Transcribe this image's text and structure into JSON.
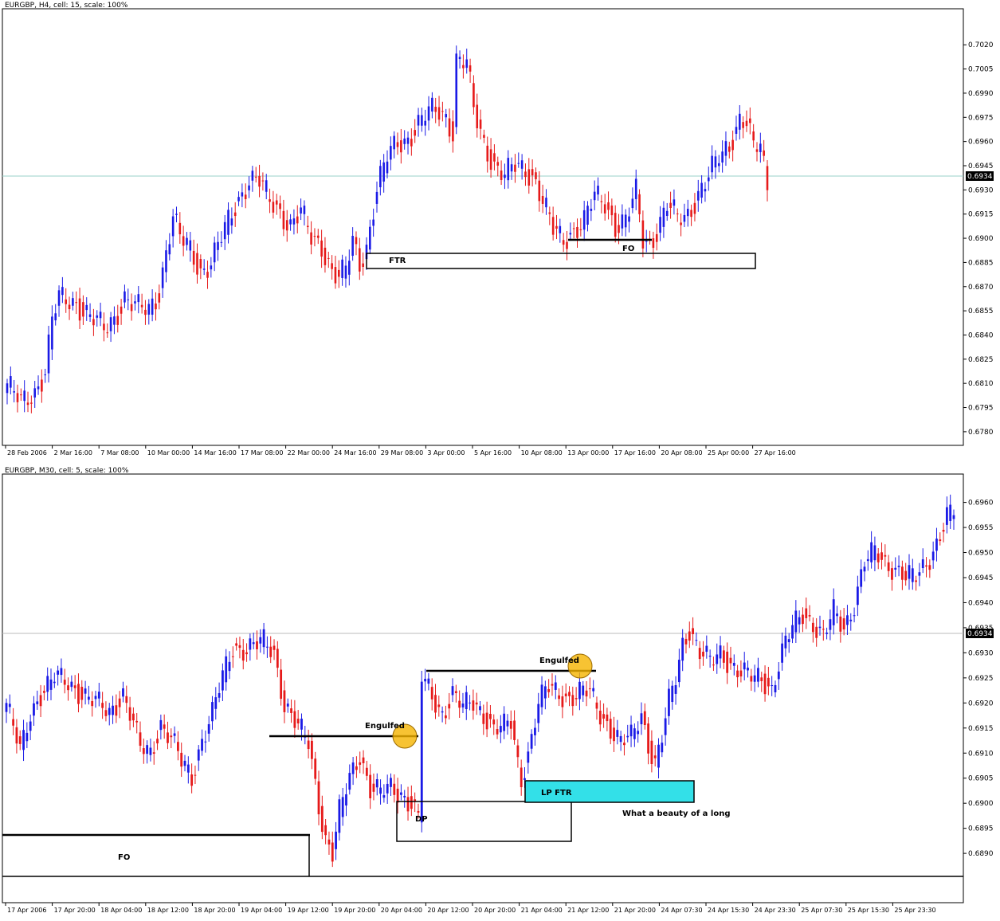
{
  "colors": {
    "bull": "#1a1ae6",
    "bear": "#e61a1a",
    "frame": "#000000",
    "grid_ref": "#9ad0c8",
    "marker": "#f5b400",
    "lp_zone": "#33e0e8"
  },
  "chart_data": [
    {
      "type": "candlestick",
      "title": "EURGBP, H4, cell: 15, scale: 100%",
      "symbol": "EURGBP",
      "timeframe": "H4",
      "ylim": [
        0.6775,
        0.703
      ],
      "y_ticks": [
        "0.7020",
        "0.7005",
        "0.6990",
        "0.6975",
        "0.6960",
        "0.6945",
        "0.6930",
        "0.6915",
        "0.6900",
        "0.6885",
        "0.6870",
        "0.6855",
        "0.6840",
        "0.6825",
        "0.6810",
        "0.6795",
        "0.6780"
      ],
      "x_ticks": [
        "28 Feb 2006",
        "2 Mar 16:00",
        "7 Mar 08:00",
        "10 Mar 00:00",
        "14 Mar 16:00",
        "17 Mar 08:00",
        "22 Mar 00:00",
        "24 Mar 16:00",
        "29 Mar 08:00",
        "3 Apr 00:00",
        "5 Apr 16:00",
        "10 Apr 08:00",
        "13 Apr 00:00",
        "17 Apr 16:00",
        "20 Apr 08:00",
        "25 Apr 00:00",
        "27 Apr 16:00"
      ],
      "current_price": "0.6934",
      "close_anchors": [
        [
          0,
          0.681
        ],
        [
          4,
          0.6797
        ],
        [
          8,
          0.6805
        ],
        [
          11,
          0.6818
        ],
        [
          13,
          0.685
        ],
        [
          15,
          0.6862
        ],
        [
          20,
          0.686
        ],
        [
          24,
          0.6852
        ],
        [
          28,
          0.6843
        ],
        [
          31,
          0.685
        ],
        [
          34,
          0.6864
        ],
        [
          38,
          0.6856
        ],
        [
          41,
          0.6855
        ],
        [
          44,
          0.6867
        ],
        [
          46,
          0.6893
        ],
        [
          48,
          0.6913
        ],
        [
          50,
          0.69
        ],
        [
          53,
          0.6893
        ],
        [
          56,
          0.688
        ],
        [
          59,
          0.6885
        ],
        [
          62,
          0.69
        ],
        [
          66,
          0.692
        ],
        [
          70,
          0.6937
        ],
        [
          73,
          0.6935
        ],
        [
          76,
          0.6923
        ],
        [
          79,
          0.6917
        ],
        [
          82,
          0.6908
        ],
        [
          85,
          0.6916
        ],
        [
          88,
          0.69
        ],
        [
          91,
          0.6896
        ],
        [
          94,
          0.688
        ],
        [
          96,
          0.6875
        ],
        [
          98,
          0.688
        ],
        [
          100,
          0.6898
        ],
        [
          102,
          0.6885
        ],
        [
          104,
          0.6895
        ],
        [
          107,
          0.693
        ],
        [
          110,
          0.695
        ],
        [
          113,
          0.696
        ],
        [
          116,
          0.6962
        ],
        [
          119,
          0.697
        ],
        [
          122,
          0.6978
        ],
        [
          125,
          0.698
        ],
        [
          127,
          0.6976
        ],
        [
          129,
          0.6966
        ],
        [
          130,
          0.701
        ],
        [
          133,
          0.7008
        ],
        [
          135,
          0.698
        ],
        [
          138,
          0.696
        ],
        [
          141,
          0.6945
        ],
        [
          144,
          0.6938
        ],
        [
          147,
          0.6945
        ],
        [
          150,
          0.6944
        ],
        [
          153,
          0.6935
        ],
        [
          155,
          0.6922
        ],
        [
          158,
          0.6905
        ],
        [
          161,
          0.69
        ],
        [
          164,
          0.6905
        ],
        [
          167,
          0.691
        ],
        [
          170,
          0.6926
        ],
        [
          173,
          0.6923
        ],
        [
          176,
          0.6908
        ],
        [
          179,
          0.691
        ],
        [
          182,
          0.6928
        ],
        [
          184,
          0.69
        ],
        [
          186,
          0.6897
        ],
        [
          188,
          0.6905
        ],
        [
          191,
          0.692
        ],
        [
          194,
          0.6912
        ],
        [
          197,
          0.6915
        ],
        [
          200,
          0.6928
        ],
        [
          203,
          0.6938
        ],
        [
          206,
          0.695
        ],
        [
          209,
          0.6958
        ],
        [
          212,
          0.6975
        ],
        [
          214,
          0.6972
        ],
        [
          216,
          0.6955
        ],
        [
          218,
          0.6957
        ],
        [
          220,
          0.6932
        ]
      ]
    },
    {
      "type": "candlestick",
      "title": "EURGBP, M30, cell: 5, scale: 100%",
      "symbol": "EURGBP",
      "timeframe": "M30",
      "ylim": [
        0.6887,
        0.6962
      ],
      "y_ticks": [
        "0.6960",
        "0.6955",
        "0.6950",
        "0.6945",
        "0.6940",
        "0.6935",
        "0.6930",
        "0.6925",
        "0.6920",
        "0.6915",
        "0.6910",
        "0.6905",
        "0.6900",
        "0.6895",
        "0.6890"
      ],
      "x_ticks": [
        "17 Apr 2006",
        "17 Apr 20:00",
        "18 Apr 04:00",
        "18 Apr 12:00",
        "18 Apr 20:00",
        "19 Apr 04:00",
        "19 Apr 12:00",
        "19 Apr 20:00",
        "20 Apr 04:00",
        "20 Apr 12:00",
        "20 Apr 20:00",
        "21 Apr 04:00",
        "21 Apr 12:00",
        "21 Apr 20:00",
        "24 Apr 07:30",
        "24 Apr 15:30",
        "24 Apr 23:30",
        "25 Apr 07:30",
        "25 Apr 15:30",
        "25 Apr 23:30"
      ],
      "current_price": "0.6934",
      "close_anchors": [
        [
          0,
          0.692
        ],
        [
          4,
          0.691
        ],
        [
          7,
          0.6918
        ],
        [
          10,
          0.6922
        ],
        [
          14,
          0.6925
        ],
        [
          18,
          0.6924
        ],
        [
          22,
          0.6922
        ],
        [
          26,
          0.692
        ],
        [
          30,
          0.6918
        ],
        [
          34,
          0.6922
        ],
        [
          36,
          0.6918
        ],
        [
          39,
          0.6911
        ],
        [
          42,
          0.691
        ],
        [
          45,
          0.6916
        ],
        [
          48,
          0.6913
        ],
        [
          51,
          0.6908
        ],
        [
          54,
          0.6905
        ],
        [
          57,
          0.6913
        ],
        [
          60,
          0.6918
        ],
        [
          63,
          0.6925
        ],
        [
          66,
          0.6931
        ],
        [
          70,
          0.6931
        ],
        [
          75,
          0.6932
        ],
        [
          78,
          0.693
        ],
        [
          81,
          0.692
        ],
        [
          85,
          0.6915
        ],
        [
          88,
          0.6912
        ],
        [
          91,
          0.69
        ],
        [
          93,
          0.6893
        ],
        [
          95,
          0.689
        ],
        [
          97,
          0.6898
        ],
        [
          100,
          0.6905
        ],
        [
          103,
          0.691
        ],
        [
          106,
          0.6903
        ],
        [
          109,
          0.6902
        ],
        [
          112,
          0.6903
        ],
        [
          115,
          0.6902
        ],
        [
          118,
          0.69
        ],
        [
          120,
          0.6897
        ],
        [
          121,
          0.6925
        ],
        [
          124,
          0.6921
        ],
        [
          127,
          0.6918
        ],
        [
          130,
          0.6922
        ],
        [
          133,
          0.6919
        ],
        [
          136,
          0.692
        ],
        [
          139,
          0.6918
        ],
        [
          142,
          0.6915
        ],
        [
          145,
          0.6915
        ],
        [
          147,
          0.6916
        ],
        [
          149,
          0.6908
        ],
        [
          150,
          0.6905
        ],
        [
          152,
          0.691
        ],
        [
          155,
          0.692
        ],
        [
          158,
          0.6923
        ],
        [
          161,
          0.6922
        ],
        [
          164,
          0.6921
        ],
        [
          167,
          0.6922
        ],
        [
          170,
          0.6922
        ],
        [
          173,
          0.6918
        ],
        [
          176,
          0.6915
        ],
        [
          179,
          0.6912
        ],
        [
          182,
          0.6913
        ],
        [
          185,
          0.6918
        ],
        [
          187,
          0.6912
        ],
        [
          189,
          0.6908
        ],
        [
          191,
          0.6913
        ],
        [
          193,
          0.692
        ],
        [
          195,
          0.6925
        ],
        [
          197,
          0.6932
        ],
        [
          199,
          0.6935
        ],
        [
          202,
          0.693
        ],
        [
          205,
          0.6928
        ],
        [
          208,
          0.693
        ],
        [
          211,
          0.6928
        ],
        [
          214,
          0.6926
        ],
        [
          217,
          0.6925
        ],
        [
          220,
          0.6925
        ],
        [
          223,
          0.6923
        ],
        [
          226,
          0.693
        ],
        [
          229,
          0.6935
        ],
        [
          232,
          0.6938
        ],
        [
          235,
          0.6936
        ],
        [
          238,
          0.6933
        ],
        [
          241,
          0.6938
        ],
        [
          244,
          0.6935
        ],
        [
          247,
          0.694
        ],
        [
          250,
          0.6948
        ],
        [
          253,
          0.695
        ],
        [
          256,
          0.6948
        ],
        [
          259,
          0.6947
        ],
        [
          262,
          0.6945
        ],
        [
          265,
          0.6945
        ],
        [
          268,
          0.6948
        ],
        [
          271,
          0.6952
        ],
        [
          274,
          0.6957
        ],
        [
          276,
          0.6958
        ]
      ]
    }
  ],
  "annotations": {
    "top": {
      "ftr": "FTR",
      "fo": "FO"
    },
    "bottom": {
      "fo": "FO",
      "dp": "DP",
      "engulfed_1": "Engulfed",
      "engulfed_2": "Engulfed",
      "lp_ftr": "LP FTR",
      "note": "What a beauty of a long"
    }
  }
}
